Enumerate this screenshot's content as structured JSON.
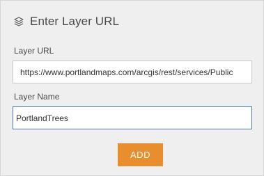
{
  "dialog": {
    "title": "Enter Layer URL",
    "icon": "layers-icon"
  },
  "fields": {
    "url_label": "Layer URL",
    "url_value": "https://www.portlandmaps.com/arcgis/rest/services/Public",
    "name_label": "Layer Name",
    "name_value": "PortlandTrees"
  },
  "actions": {
    "add_label": "ADD"
  },
  "colors": {
    "accent": "#e98e2e",
    "focus_border": "#4a78b8",
    "panel_bg": "#efefef"
  }
}
